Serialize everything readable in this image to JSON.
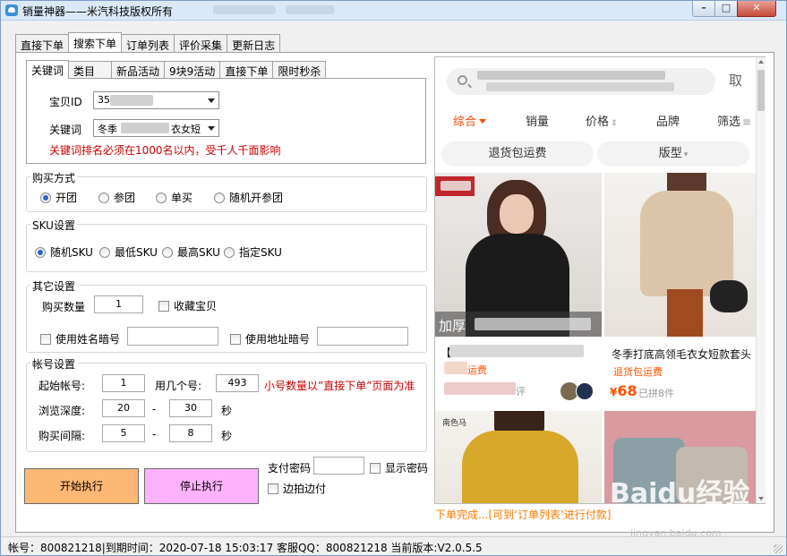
{
  "window": {
    "title": "销量神器——米汽科技版权所有"
  },
  "main_tabs": [
    "直接下单",
    "搜索下单",
    "订单列表",
    "评价采集",
    "更新日志"
  ],
  "sub_tabs": [
    "关键词",
    "类目",
    "新品活动",
    "9块9活动",
    "直接下单",
    "限时秒杀"
  ],
  "keyword_panel": {
    "item_id_label": "宝贝ID",
    "item_id_value": "35",
    "keyword_label": "关键词",
    "keyword_value_prefix": "冬季",
    "keyword_value_suffix": "衣女短",
    "warning": "关键词排名必须在1000名以内，受千人千面影响"
  },
  "buy_mode": {
    "title": "购买方式",
    "options": [
      "开团",
      "参团",
      "单买",
      "随机开参团"
    ],
    "selected": "开团"
  },
  "sku": {
    "title": "SKU设置",
    "options": [
      "随机SKU",
      "最低SKU",
      "最高SKU",
      "指定SKU"
    ],
    "selected": "随机SKU"
  },
  "other": {
    "title": "其它设置",
    "qty_label": "购买数量",
    "qty_value": "1",
    "favorite_label": "收藏宝贝",
    "name_code_label": "使用姓名暗号",
    "addr_code_label": "使用地址暗号"
  },
  "account": {
    "title": "帐号设置",
    "start_label": "起始帐号:",
    "start_value": "1",
    "count_label": "用几个号:",
    "count_value": "493",
    "count_note": "小号数量以”直接下单”页面为准",
    "depth_label": "浏览深度:",
    "depth_min": "20",
    "depth_max": "30",
    "interval_label": "购买间隔:",
    "interval_min": "5",
    "interval_max": "8",
    "dash": "-",
    "unit": "秒"
  },
  "actions": {
    "start": "开始执行",
    "stop": "停止执行",
    "pay_password_label": "支付密码",
    "show_password_label": "显示密码",
    "pay_while_shoot_label": "边拍边付"
  },
  "browser": {
    "cancel": "取",
    "filters": [
      "综合",
      "销量",
      "价格",
      "品牌",
      "筛选"
    ],
    "pills": [
      "退货包运费",
      "版型"
    ],
    "products": [
      {
        "title": "【",
        "tag": "运费",
        "price": "",
        "sold": "评"
      },
      {
        "title": "冬季打底高领毛衣女短款套头",
        "tag": "退货包运费",
        "price": "68",
        "sold": "已拼8件"
      }
    ],
    "currency": "¥",
    "image_text_left": "加厚",
    "image_text_bottom": "南色马",
    "progress_text": "下单完成...[可到‘订单列表’进行付款]"
  },
  "status": {
    "text": "帐号：800821218|到期时间：2020-07-18 15:03:17  客服QQ：800821218  当前版本:V2.0.5.5"
  },
  "watermark": {
    "main": "Baidu经验",
    "sub": "jingyan.baidu.com"
  },
  "colors": {
    "accent": "#ff5000",
    "warning": "#c80000",
    "start_button": "#ffb774",
    "stop_button": "#ffb3ff"
  }
}
